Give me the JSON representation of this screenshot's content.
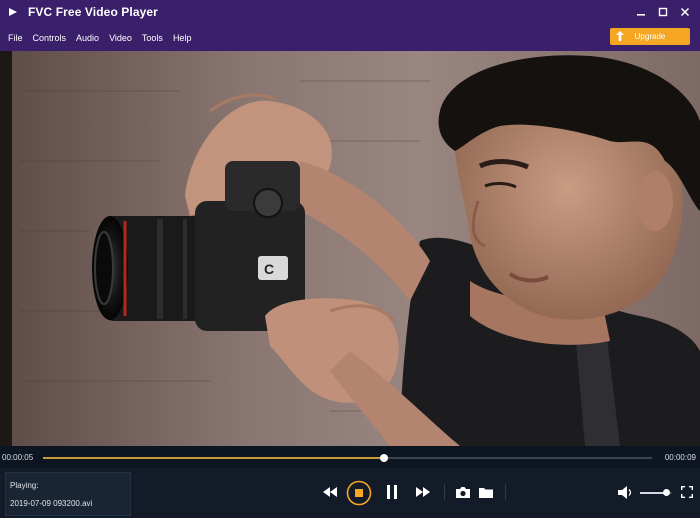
{
  "window": {
    "title": "FVC Free Video Player",
    "icons": [
      "app-logo-icon",
      "minimize-icon",
      "maximize-icon",
      "close-icon"
    ]
  },
  "menu": {
    "items": [
      "File",
      "Controls",
      "Audio",
      "Video",
      "Tools",
      "Help"
    ],
    "upgrade_label": "Upgrade"
  },
  "playback": {
    "current_time": "00:00:05",
    "total_time": "00:00:09",
    "progress_fraction": 0.56,
    "volume_fraction": 0.85,
    "playing_label": "Playing:",
    "file_name": "2019-07-09 093200.avi"
  },
  "colors": {
    "titlebar": "#3a1f6b",
    "accent": "#f5a623",
    "controls_bg": "#121b27"
  }
}
